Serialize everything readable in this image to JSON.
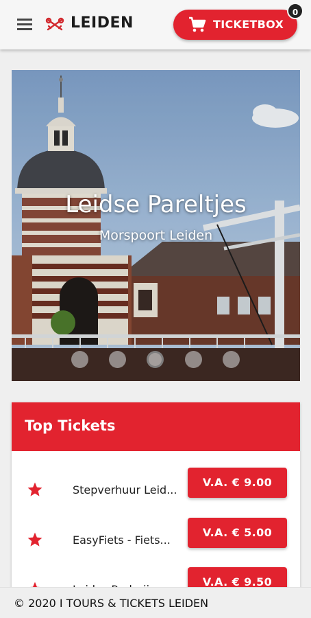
{
  "header": {
    "brand": "LEIDEN",
    "ticketbox_label": "TICKETBOX",
    "cart_count": "0",
    "accent_color": "#e2232f",
    "icons": [
      "menu-icon",
      "leiden-keys-logo-icon",
      "shopping-cart-icon"
    ]
  },
  "hero": {
    "title": "Leidse Pareltjes",
    "subtitle": "Morspoort Leiden",
    "slide_count": 5,
    "active_slide": 3
  },
  "top_tickets": {
    "heading": "Top Tickets",
    "items": [
      {
        "name": "Stepverhuur Leid...",
        "price": "V.A. € 9.00",
        "icon": "star-icon"
      },
      {
        "name": "EasyFiets - Fiets...",
        "price": "V.A. € 5.00",
        "icon": "star-icon"
      },
      {
        "name": "Leidse Rederii",
        "price": "V.A. € 9.50",
        "icon": "star-icon"
      }
    ]
  },
  "footer": {
    "text": "© 2020 I TOURS & TICKETS LEIDEN"
  }
}
